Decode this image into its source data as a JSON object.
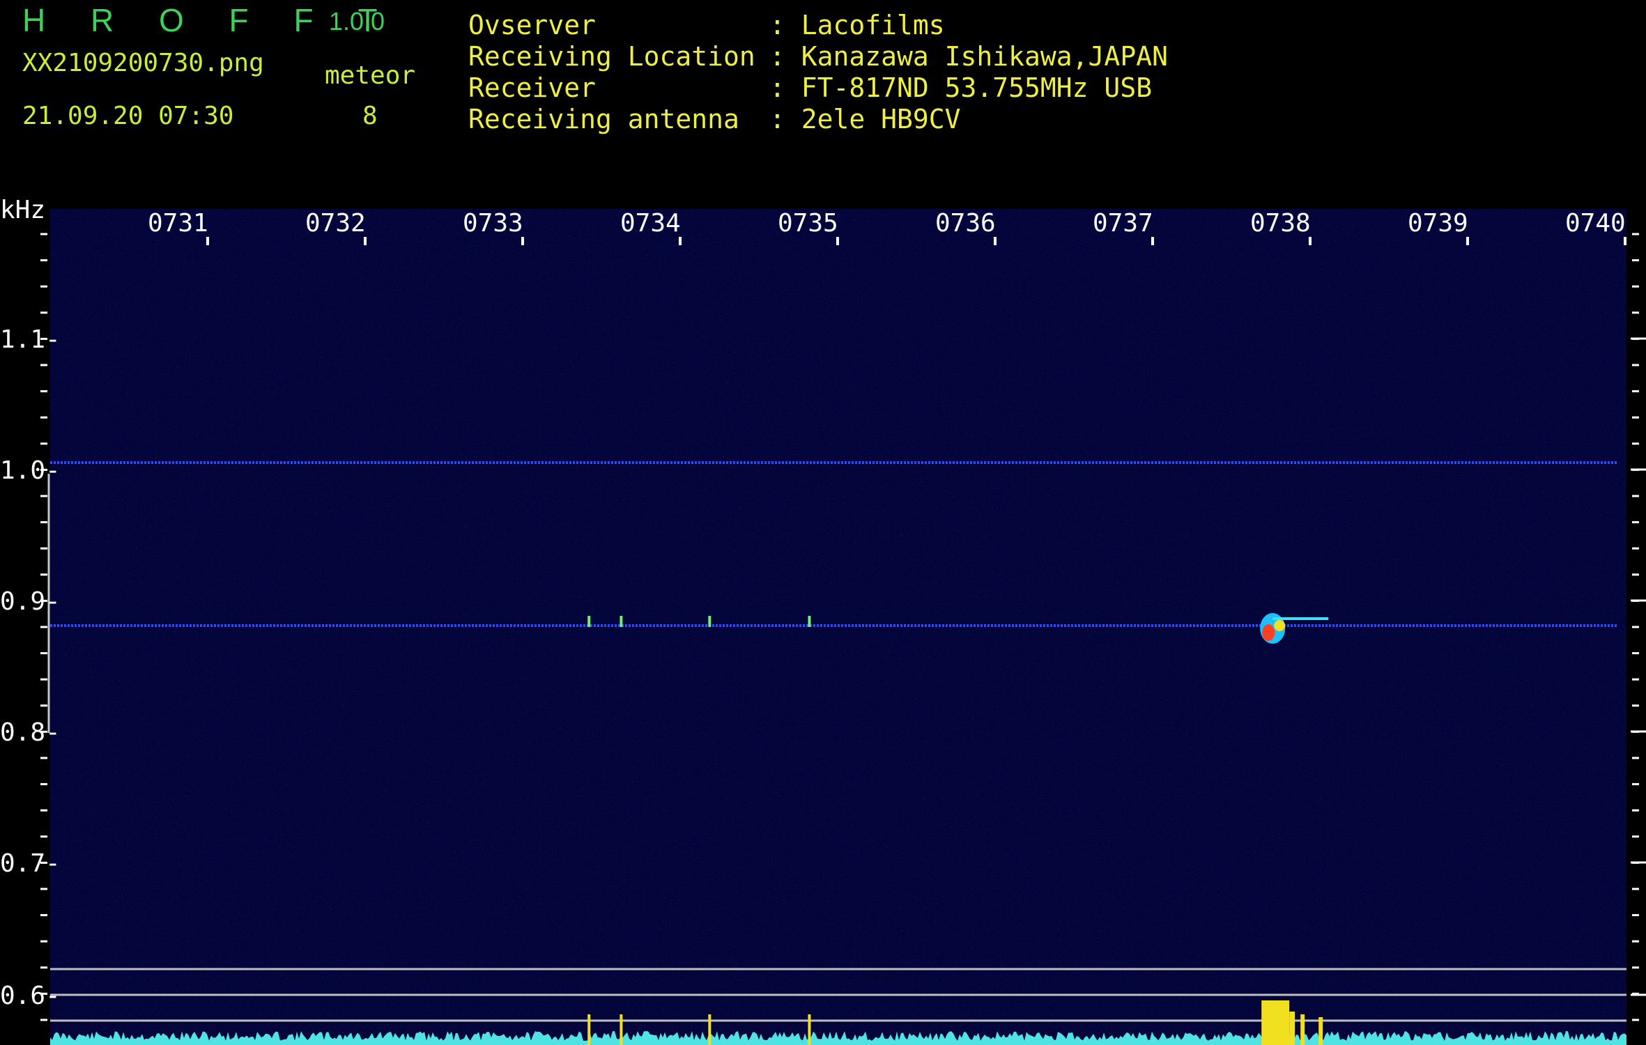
{
  "header": {
    "app_name": "H R O F F T",
    "version": "1.0.0",
    "filename": "XX2109200730.png",
    "datetime": "21.09.20 07:30",
    "meteor_label": "meteor",
    "meteor_count": "8"
  },
  "station_info": [
    {
      "label": "Ovserver",
      "value": ": Lacofilms"
    },
    {
      "label": "Receiving Location",
      "value": ": Kanazawa Ishikawa,JAPAN"
    },
    {
      "label": "Receiver",
      "value": ": FT-817ND 53.755MHz USB"
    },
    {
      "label": "Receiving antenna",
      "value": ": 2ele HB9CV"
    }
  ],
  "colors": {
    "background": "#000000",
    "spectrogram_bg": "#03053a",
    "carrier_line": "#2a4cff",
    "amplitude_trace": "#4fe3e3",
    "meteor_burst": "#f0e020",
    "title_green": "#3cd25a",
    "info_yellow": "#eeee44"
  },
  "chart_data": {
    "type": "heatmap",
    "ylabel": "kHz",
    "x_tick_labels": [
      "0731",
      "0732",
      "0733",
      "0734",
      "0735",
      "0736",
      "0737",
      "0738",
      "0739",
      "0740"
    ],
    "y_tick_labels": [
      "1.1-",
      "1.0-",
      "0.9-",
      "0.8-",
      "0.7-",
      "0.6-"
    ],
    "x_time_minutes": [
      31,
      32,
      33,
      34,
      35,
      36,
      37,
      38,
      39,
      40
    ],
    "y_values_khz": [
      1.1,
      1.0,
      0.9,
      0.8,
      0.7,
      0.6
    ],
    "xlim_minutes": [
      30.2,
      40.0
    ],
    "ylim_khz": [
      0.6,
      1.2
    ],
    "carrier_lines_khz": [
      1.005,
      0.88
    ],
    "reference_lines_khz": [
      0.62,
      0.6,
      0.58
    ],
    "meteor_echoes": [
      {
        "time_min": 37.8,
        "freq_khz": 0.88,
        "strength": "strong"
      },
      {
        "time_min": 33.55,
        "freq_khz": 0.882,
        "strength": "weak"
      },
      {
        "time_min": 33.75,
        "freq_khz": 0.882,
        "strength": "weak"
      },
      {
        "time_min": 34.3,
        "freq_khz": 0.883,
        "strength": "weak"
      },
      {
        "time_min": 34.92,
        "freq_khz": 0.874,
        "strength": "weak"
      }
    ]
  }
}
